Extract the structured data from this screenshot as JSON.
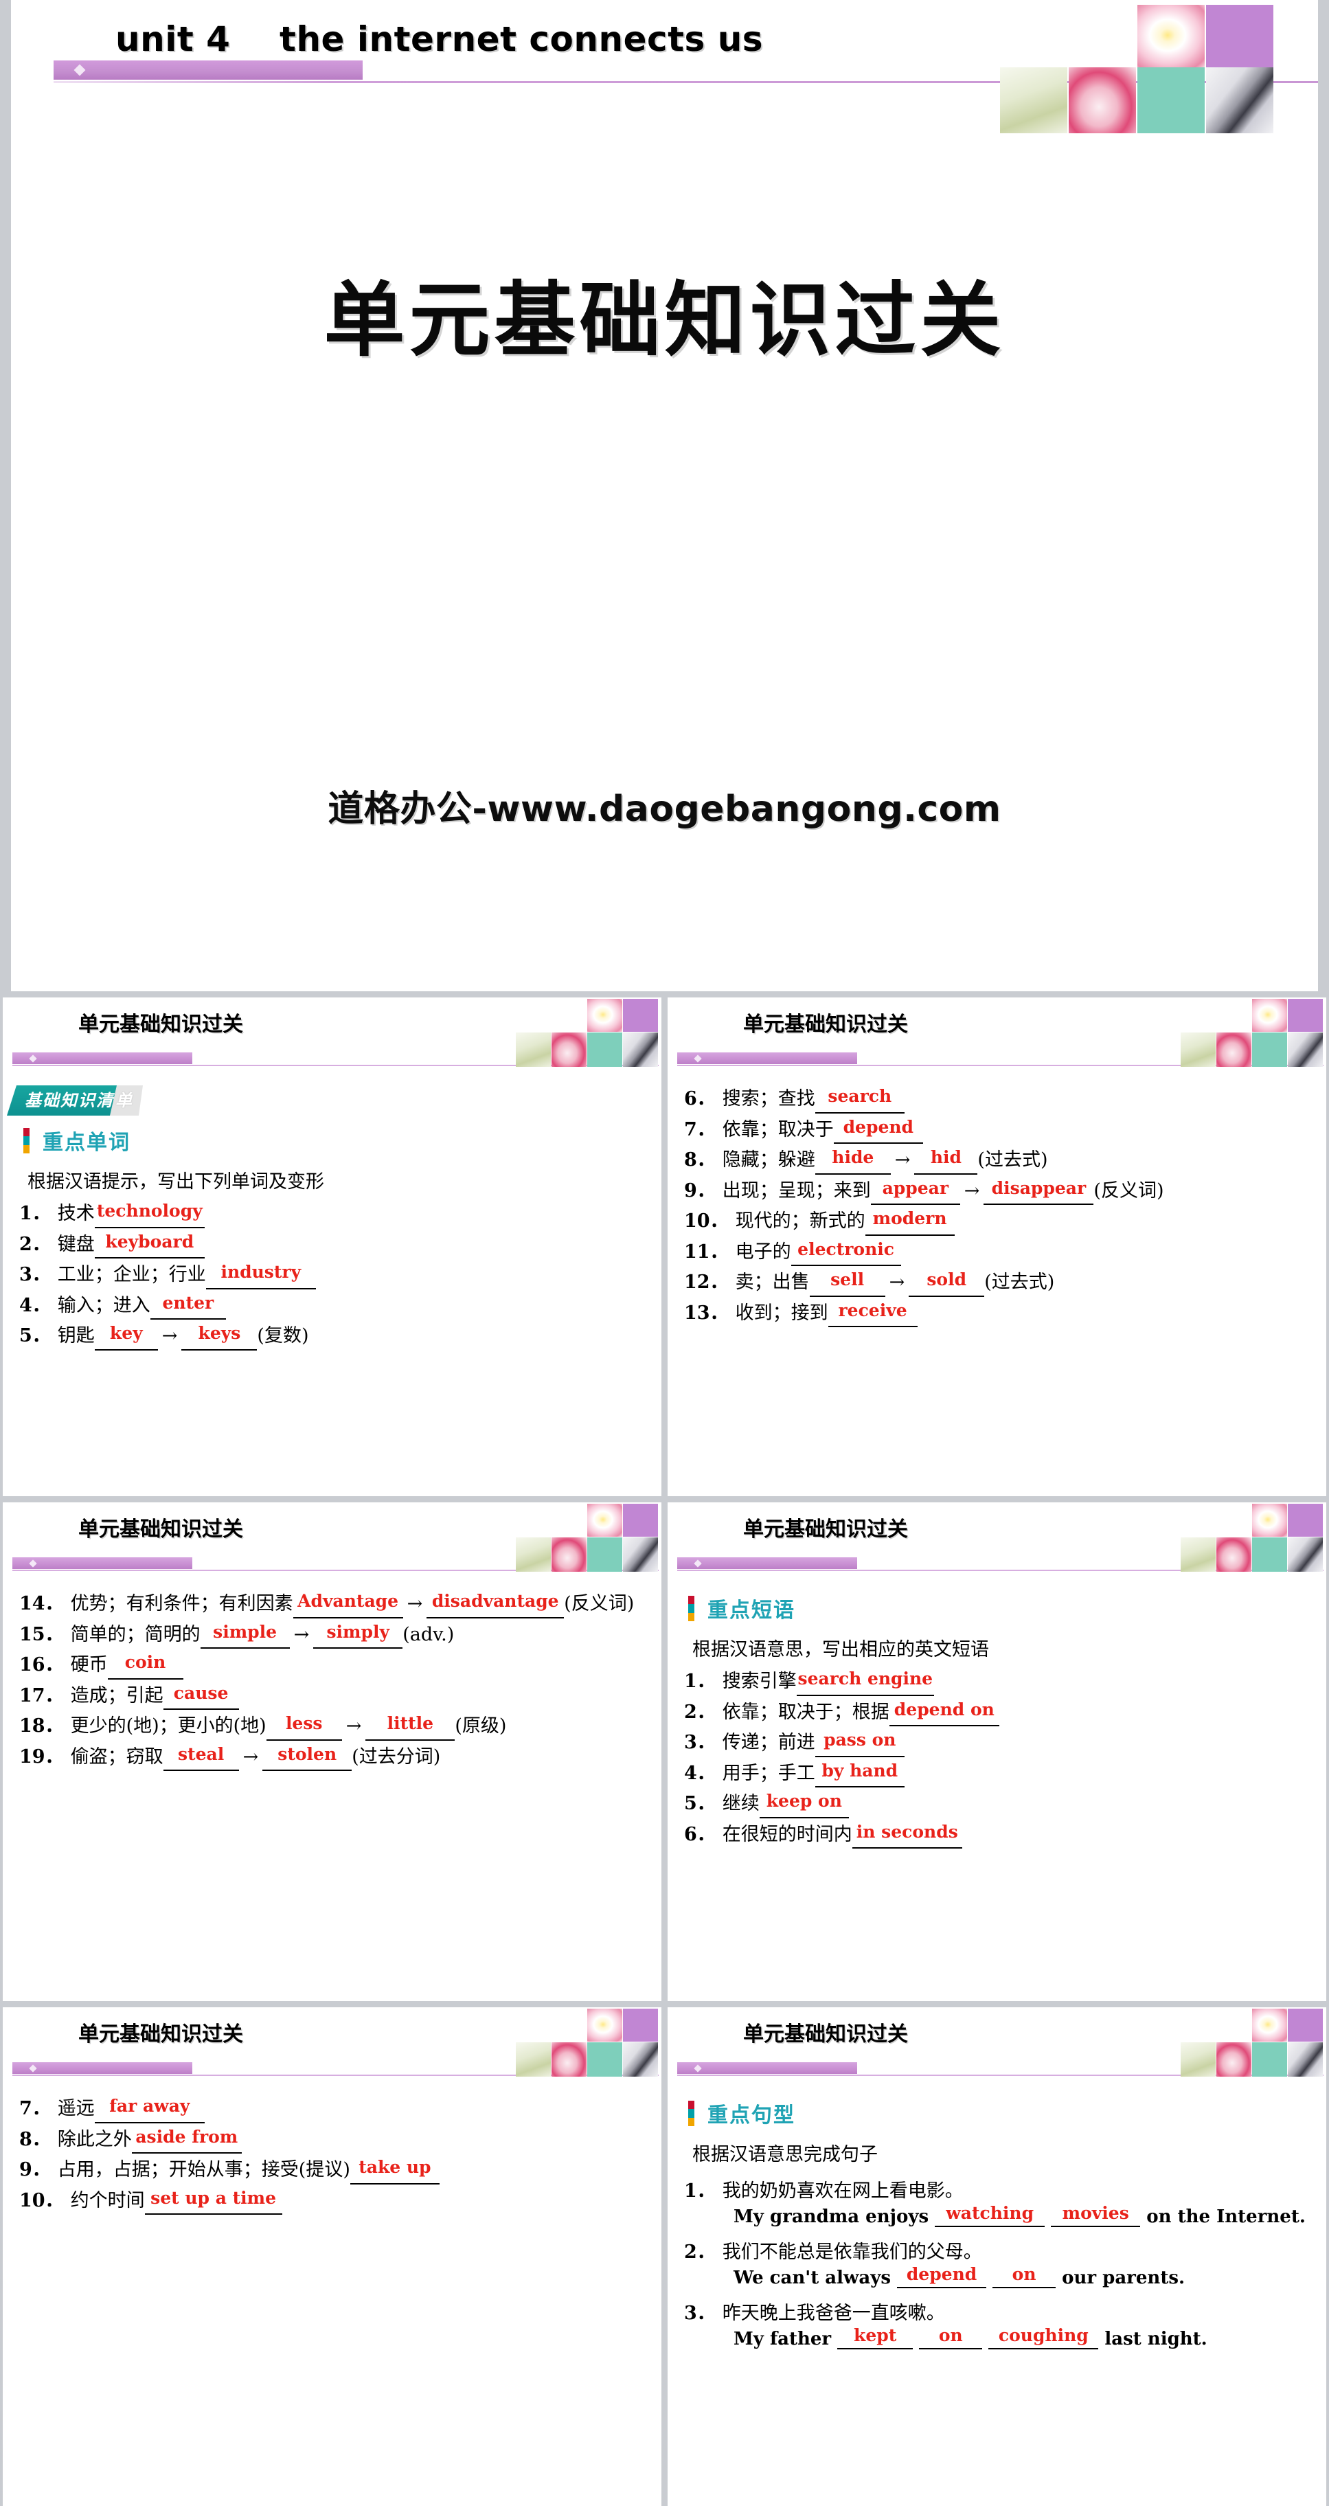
{
  "hero": {
    "unit_title": "unit 4    the internet connects us",
    "main_title": "单元基础知识过关",
    "watermark": "道格办公-www.daogebangong.com"
  },
  "colors": {
    "answer_red": "#e8221a",
    "accent_purple": "#c58fd0",
    "accent_teal": "#0f9b9b",
    "heading_teal": "#1fa3b4",
    "tab_red": "#c8102e",
    "tab_teal": "#00a0a8",
    "tab_orange": "#f0a500",
    "page_bg": "#c9ccd1"
  },
  "slide_title": "单元基础知识过关",
  "badge": {
    "main": "基础知识清",
    "tail": "单"
  },
  "slides": [
    {
      "id": "slide-words-1",
      "subhead": "重点单词",
      "prompt": "根据汉语提示，写出下列单词及变形",
      "items": [
        {
          "num": "1．",
          "cn": "技术",
          "blanks": [
            "technology"
          ],
          "tail": ""
        },
        {
          "num": "2．",
          "cn": "键盘",
          "blanks": [
            "keyboard"
          ],
          "tail": ""
        },
        {
          "num": "3．",
          "cn": "工业；企业；行业",
          "blanks": [
            "industry"
          ],
          "tail": ""
        },
        {
          "num": "4．",
          "cn": "输入；进入",
          "blanks": [
            "enter"
          ],
          "tail": ""
        },
        {
          "num": "5．",
          "cn": "钥匙",
          "blanks": [
            "key",
            "keys"
          ],
          "tail": "(复数)"
        }
      ]
    },
    {
      "id": "slide-words-2",
      "items": [
        {
          "num": "6．",
          "cn": "搜索；查找",
          "blanks": [
            "search"
          ],
          "tail": ""
        },
        {
          "num": "7．",
          "cn": "依靠；取决于",
          "blanks": [
            "depend"
          ],
          "tail": ""
        },
        {
          "num": "8．",
          "cn": "隐藏；躲避",
          "blanks": [
            "hide",
            "hid"
          ],
          "tail": "(过去式)"
        },
        {
          "num": "9．",
          "cn": "出现；呈现；来到",
          "blanks": [
            "appear",
            "disappear"
          ],
          "tail": "(反义词)"
        },
        {
          "num": "10．",
          "cn": "现代的；新式的",
          "blanks": [
            "modern"
          ],
          "tail": ""
        },
        {
          "num": "11．",
          "cn": "电子的",
          "blanks": [
            "electronic"
          ],
          "tail": ""
        },
        {
          "num": "12．",
          "cn": "卖；出售",
          "blanks": [
            "sell",
            "sold"
          ],
          "tail": "(过去式)"
        },
        {
          "num": "13．",
          "cn": "收到；接到",
          "blanks": [
            "receive"
          ],
          "tail": ""
        }
      ]
    },
    {
      "id": "slide-words-3",
      "items": [
        {
          "num": "14．",
          "cn": "优势；有利条件；有利因素",
          "blanks": [
            "Advantage",
            "disadvantage"
          ],
          "tail": "(反义词)"
        },
        {
          "num": "15．",
          "cn": "简单的；简明的",
          "blanks": [
            "simple",
            "simply"
          ],
          "tail": "(adv.)"
        },
        {
          "num": "16．",
          "cn": "硬币",
          "blanks": [
            "coin"
          ],
          "tail": ""
        },
        {
          "num": "17．",
          "cn": "造成；引起",
          "blanks": [
            "cause"
          ],
          "tail": ""
        },
        {
          "num": "18．",
          "cn": "更少的(地)；更小的(地)",
          "blanks": [
            "less",
            "little"
          ],
          "tail": "(原级)"
        },
        {
          "num": "19．",
          "cn": "偷盗；窃取",
          "blanks": [
            "steal",
            "stolen"
          ],
          "tail": "(过去分词)"
        }
      ]
    },
    {
      "id": "slide-phrases-1",
      "subhead": "重点短语",
      "prompt": "根据汉语意思，写出相应的英文短语",
      "items": [
        {
          "num": "1．",
          "cn": "搜索引擎",
          "blanks": [
            "search engine"
          ],
          "tail": ""
        },
        {
          "num": "2．",
          "cn": "依靠；取决于；根据",
          "blanks": [
            "depend on"
          ],
          "tail": ""
        },
        {
          "num": "3．",
          "cn": "传递；前进",
          "blanks": [
            "pass on"
          ],
          "tail": ""
        },
        {
          "num": "4．",
          "cn": "用手；手工",
          "blanks": [
            "by hand"
          ],
          "tail": ""
        },
        {
          "num": "5．",
          "cn": "继续",
          "blanks": [
            "keep on"
          ],
          "tail": ""
        },
        {
          "num": "6．",
          "cn": "在很短的时间内",
          "blanks": [
            "in seconds"
          ],
          "tail": ""
        }
      ]
    },
    {
      "id": "slide-phrases-2",
      "items": [
        {
          "num": "7．",
          "cn": "遥远",
          "blanks": [
            "far away"
          ],
          "tail": ""
        },
        {
          "num": "8．",
          "cn": "除此之外",
          "blanks": [
            "aside from"
          ],
          "tail": ""
        },
        {
          "num": "9．",
          "cn": "占用，占据；开始从事；接受(提议)",
          "blanks": [
            "take up"
          ],
          "tail": ""
        },
        {
          "num": "10．",
          "cn": "约个时间",
          "blanks": [
            "set up a time"
          ],
          "tail": ""
        }
      ]
    },
    {
      "id": "slide-sentences",
      "subhead": "重点句型",
      "prompt": "根据汉语意思完成句子",
      "sentences": [
        {
          "num": "1．",
          "cn": "我的奶奶喜欢在网上看电影。",
          "lead": "My grandma enjoys",
          "blanks": [
            "watching",
            "movies"
          ],
          "tail": "on the Internet."
        },
        {
          "num": "2．",
          "cn": "我们不能总是依靠我们的父母。",
          "lead": "We can't always",
          "blanks": [
            "depend",
            "on"
          ],
          "tail": "our parents."
        },
        {
          "num": "3．",
          "cn": "昨天晚上我爸爸一直咳嗽。",
          "lead": "My father",
          "blanks": [
            "kept",
            "on",
            "coughing"
          ],
          "tail": "last night."
        }
      ]
    }
  ]
}
